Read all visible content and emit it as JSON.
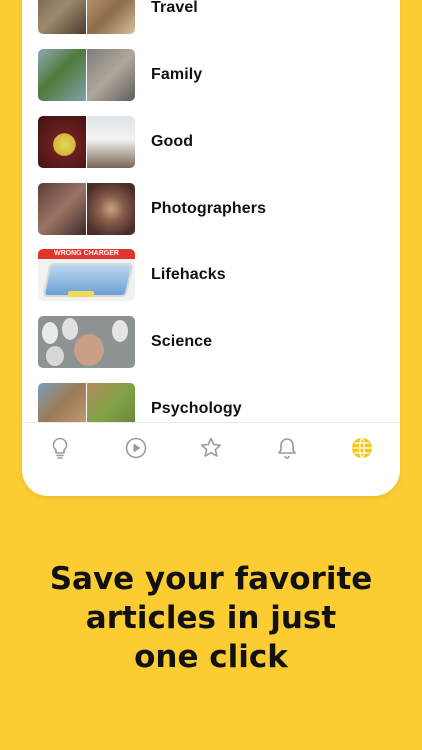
{
  "categories": [
    {
      "label": "Travel"
    },
    {
      "label": "Family"
    },
    {
      "label": "Good"
    },
    {
      "label": "Photographers"
    },
    {
      "label": "Lifehacks"
    },
    {
      "label": "Science"
    },
    {
      "label": "Psychology"
    }
  ],
  "lifehacks_thumb_text": "WRONG CHARGER",
  "tabbar": {
    "tabs": [
      {
        "icon": "lightbulb-icon",
        "active": false
      },
      {
        "icon": "play-icon",
        "active": false
      },
      {
        "icon": "star-icon",
        "active": false
      },
      {
        "icon": "bell-icon",
        "active": false
      },
      {
        "icon": "globe-icon",
        "active": true
      }
    ],
    "active_color": "#F5C518",
    "inactive_color": "#9a9a9a"
  },
  "caption": {
    "line1": "Save your favorite",
    "line2": "articles in just",
    "line3": "one click"
  },
  "colors": {
    "background": "#FCCD33"
  }
}
